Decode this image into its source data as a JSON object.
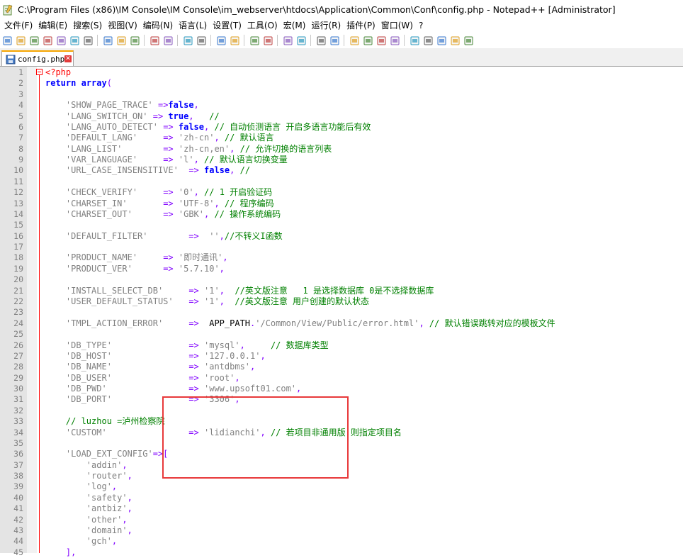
{
  "window": {
    "title": "C:\\Program Files (x86)\\IM Console\\IM Console\\im_webserver\\htdocs\\Application\\Common\\Conf\\config.php - Notepad++ [Administrator]"
  },
  "menu": [
    "文件(F)",
    "编辑(E)",
    "搜索(S)",
    "视图(V)",
    "编码(N)",
    "语言(L)",
    "设置(T)",
    "工具(O)",
    "宏(M)",
    "运行(R)",
    "插件(P)",
    "窗口(W)",
    "?"
  ],
  "toolbar": {
    "icons": [
      "new-file-icon",
      "open-file-icon",
      "save-icon",
      "save-all-icon",
      "close-icon",
      "close-all-icon",
      "print-icon",
      "cut-icon",
      "copy-icon",
      "paste-icon",
      "undo-icon",
      "redo-icon",
      "find-icon",
      "replace-icon",
      "zoom-in-icon",
      "zoom-out-icon",
      "sync-vertical-icon",
      "sync-horizontal-icon",
      "word-wrap-icon",
      "show-all-chars-icon",
      "indent-guide-icon",
      "user-language-icon",
      "doc-map-icon",
      "function-list-icon",
      "folder-workspace-icon",
      "monitoring-icon",
      "record-macro-icon",
      "stop-macro-icon",
      "play-macro-icon",
      "run-macro-multiple-icon",
      "save-macro-icon"
    ]
  },
  "tab": {
    "label": "config.php"
  },
  "colors": {
    "highlight_box": "#e8393a",
    "tab_accent": "#f6a500"
  },
  "lines": [
    {
      "n": "1",
      "html": "<span class=\"php\">&lt;?php</span>"
    },
    {
      "n": "2",
      "html": "<span class=\"k\">return</span> <span class=\"k\">array</span><span class=\"o\">(</span>"
    },
    {
      "n": "3",
      "html": ""
    },
    {
      "n": "4",
      "html": "    <span class=\"s\">'SHOW_PAGE_TRACE'</span> <span class=\"o\">=&gt;</span><span class=\"k\">false</span><span class=\"o\">,</span>"
    },
    {
      "n": "5",
      "html": "    <span class=\"s\">'LANG_SWITCH_ON'</span> <span class=\"o\">=&gt;</span> <span class=\"k\">true</span><span class=\"o\">,</span>   <span class=\"c\">//</span>"
    },
    {
      "n": "6",
      "html": "    <span class=\"s\">'LANG_AUTO_DETECT'</span> <span class=\"o\">=&gt;</span> <span class=\"k\">false</span><span class=\"o\">,</span> <span class=\"c\">// 自动侦测语言 开启多语言功能后有效</span>"
    },
    {
      "n": "7",
      "html": "    <span class=\"s\">'DEFAULT_LANG'</span>     <span class=\"o\">=&gt;</span> <span class=\"s\">'zh-cn'</span><span class=\"o\">,</span> <span class=\"c\">// 默认语言</span>"
    },
    {
      "n": "8",
      "html": "    <span class=\"s\">'LANG_LIST'</span>        <span class=\"o\">=&gt;</span> <span class=\"s\">'zh-cn,en'</span><span class=\"o\">,</span> <span class=\"c\">// 允许切换的语言列表</span>"
    },
    {
      "n": "9",
      "html": "    <span class=\"s\">'VAR_LANGUAGE'</span>     <span class=\"o\">=&gt;</span> <span class=\"s\">'l'</span><span class=\"o\">,</span> <span class=\"c\">// 默认语言切换变量</span>"
    },
    {
      "n": "10",
      "html": "    <span class=\"s\">'URL_CASE_INSENSITIVE'</span>  <span class=\"o\">=&gt;</span> <span class=\"k\">false</span><span class=\"o\">,</span> <span class=\"c\">//</span>"
    },
    {
      "n": "11",
      "html": ""
    },
    {
      "n": "12",
      "html": "    <span class=\"s\">'CHECK_VERIFY'</span>     <span class=\"o\">=&gt;</span> <span class=\"s\">'0'</span><span class=\"o\">,</span> <span class=\"c\">// 1 开启验证码</span>"
    },
    {
      "n": "13",
      "html": "    <span class=\"s\">'CHARSET_IN'</span>       <span class=\"o\">=&gt;</span> <span class=\"s\">'UTF-8'</span><span class=\"o\">,</span> <span class=\"c\">// 程序编码</span>"
    },
    {
      "n": "14",
      "html": "    <span class=\"s\">'CHARSET_OUT'</span>      <span class=\"o\">=&gt;</span> <span class=\"s\">'GBK'</span><span class=\"o\">,</span> <span class=\"c\">// 操作系统编码</span>"
    },
    {
      "n": "15",
      "html": ""
    },
    {
      "n": "16",
      "html": "    <span class=\"s\">'DEFAULT_FILTER'</span>        <span class=\"o\">=&gt;</span>  <span class=\"s\">''</span><span class=\"o\">,</span><span class=\"c\">//不转义I函数</span>"
    },
    {
      "n": "17",
      "html": ""
    },
    {
      "n": "18",
      "html": "    <span class=\"s\">'PRODUCT_NAME'</span>     <span class=\"o\">=&gt;</span> <span class=\"s\">'即时通讯'</span><span class=\"o\">,</span>"
    },
    {
      "n": "19",
      "html": "    <span class=\"s\">'PRODUCT_VER'</span>      <span class=\"o\">=&gt;</span> <span class=\"s\">'5.7.10'</span><span class=\"o\">,</span>"
    },
    {
      "n": "20",
      "html": ""
    },
    {
      "n": "21",
      "html": "    <span class=\"s\">'INSTALL_SELECT_DB'</span>     <span class=\"o\">=&gt;</span> <span class=\"s\">'1'</span><span class=\"o\">,</span>  <span class=\"c\">//英文版注意   1 是选择数据库 0是不选择数据库</span>"
    },
    {
      "n": "22",
      "html": "    <span class=\"s\">'USER_DEFAULT_STATUS'</span>   <span class=\"o\">=&gt;</span> <span class=\"s\">'1'</span><span class=\"o\">,</span>  <span class=\"c\">//英文版注意 用户创建的默认状态</span>"
    },
    {
      "n": "23",
      "html": ""
    },
    {
      "n": "24",
      "html": "    <span class=\"s\">'TMPL_ACTION_ERROR'</span>     <span class=\"o\">=&gt;</span>  <span class=\"plain\">APP_PATH</span><span class=\"o\">.</span><span class=\"s\">'/Common/View/Public/error.html'</span><span class=\"o\">,</span> <span class=\"c\">// 默认错误跳转对应的模板文件</span>"
    },
    {
      "n": "25",
      "html": ""
    },
    {
      "n": "26",
      "html": "    <span class=\"s\">'DB_TYPE'</span>               <span class=\"o\">=&gt;</span> <span class=\"s\">'mysql'</span><span class=\"o\">,</span>     <span class=\"c\">// 数据库类型</span>"
    },
    {
      "n": "27",
      "html": "    <span class=\"s\">'DB_HOST'</span>               <span class=\"o\">=&gt;</span> <span class=\"s\">'127.0.0.1'</span><span class=\"o\">,</span>"
    },
    {
      "n": "28",
      "html": "    <span class=\"s\">'DB_NAME'</span>               <span class=\"o\">=&gt;</span> <span class=\"s\">'antdbms'</span><span class=\"o\">,</span>"
    },
    {
      "n": "29",
      "html": "    <span class=\"s\">'DB_USER'</span>               <span class=\"o\">=&gt;</span> <span class=\"s\">'root'</span><span class=\"o\">,</span>"
    },
    {
      "n": "30",
      "html": "    <span class=\"s\">'DB_PWD'</span>                <span class=\"o\">=&gt;</span> <span class=\"s\">'www.upsoft01.com'</span><span class=\"o\">,</span>"
    },
    {
      "n": "31",
      "html": "    <span class=\"s\">'DB_PORT'</span>               <span class=\"o\">=&gt;</span> <span class=\"s\">'3306'</span><span class=\"o\">,</span>"
    },
    {
      "n": "32",
      "html": ""
    },
    {
      "n": "33",
      "html": "    <span class=\"c\">// luzhou =泸州检察院</span>"
    },
    {
      "n": "34",
      "html": "    <span class=\"s\">'CUSTOM'</span>                <span class=\"o\">=&gt;</span> <span class=\"s\">'lidianchi'</span><span class=\"o\">,</span> <span class=\"c\">// 若项目非通用版,则指定项目名</span>"
    },
    {
      "n": "35",
      "html": ""
    },
    {
      "n": "36",
      "html": "    <span class=\"s\">'LOAD_EXT_CONFIG'</span><span class=\"o\">=&gt;[</span>"
    },
    {
      "n": "37",
      "html": "        <span class=\"s\">'addin'</span><span class=\"o\">,</span>"
    },
    {
      "n": "38",
      "html": "        <span class=\"s\">'router'</span><span class=\"o\">,</span>"
    },
    {
      "n": "39",
      "html": "        <span class=\"s\">'log'</span><span class=\"o\">,</span>"
    },
    {
      "n": "40",
      "html": "        <span class=\"s\">'safety'</span><span class=\"o\">,</span>"
    },
    {
      "n": "41",
      "html": "        <span class=\"s\">'antbiz'</span><span class=\"o\">,</span>"
    },
    {
      "n": "42",
      "html": "        <span class=\"s\">'other'</span><span class=\"o\">,</span>"
    },
    {
      "n": "43",
      "html": "        <span class=\"s\">'domain'</span><span class=\"o\">,</span>"
    },
    {
      "n": "44",
      "html": "        <span class=\"s\">'gch'</span><span class=\"o\">,</span>"
    },
    {
      "n": "45",
      "html": "    <span class=\"o\">],</span>"
    }
  ]
}
